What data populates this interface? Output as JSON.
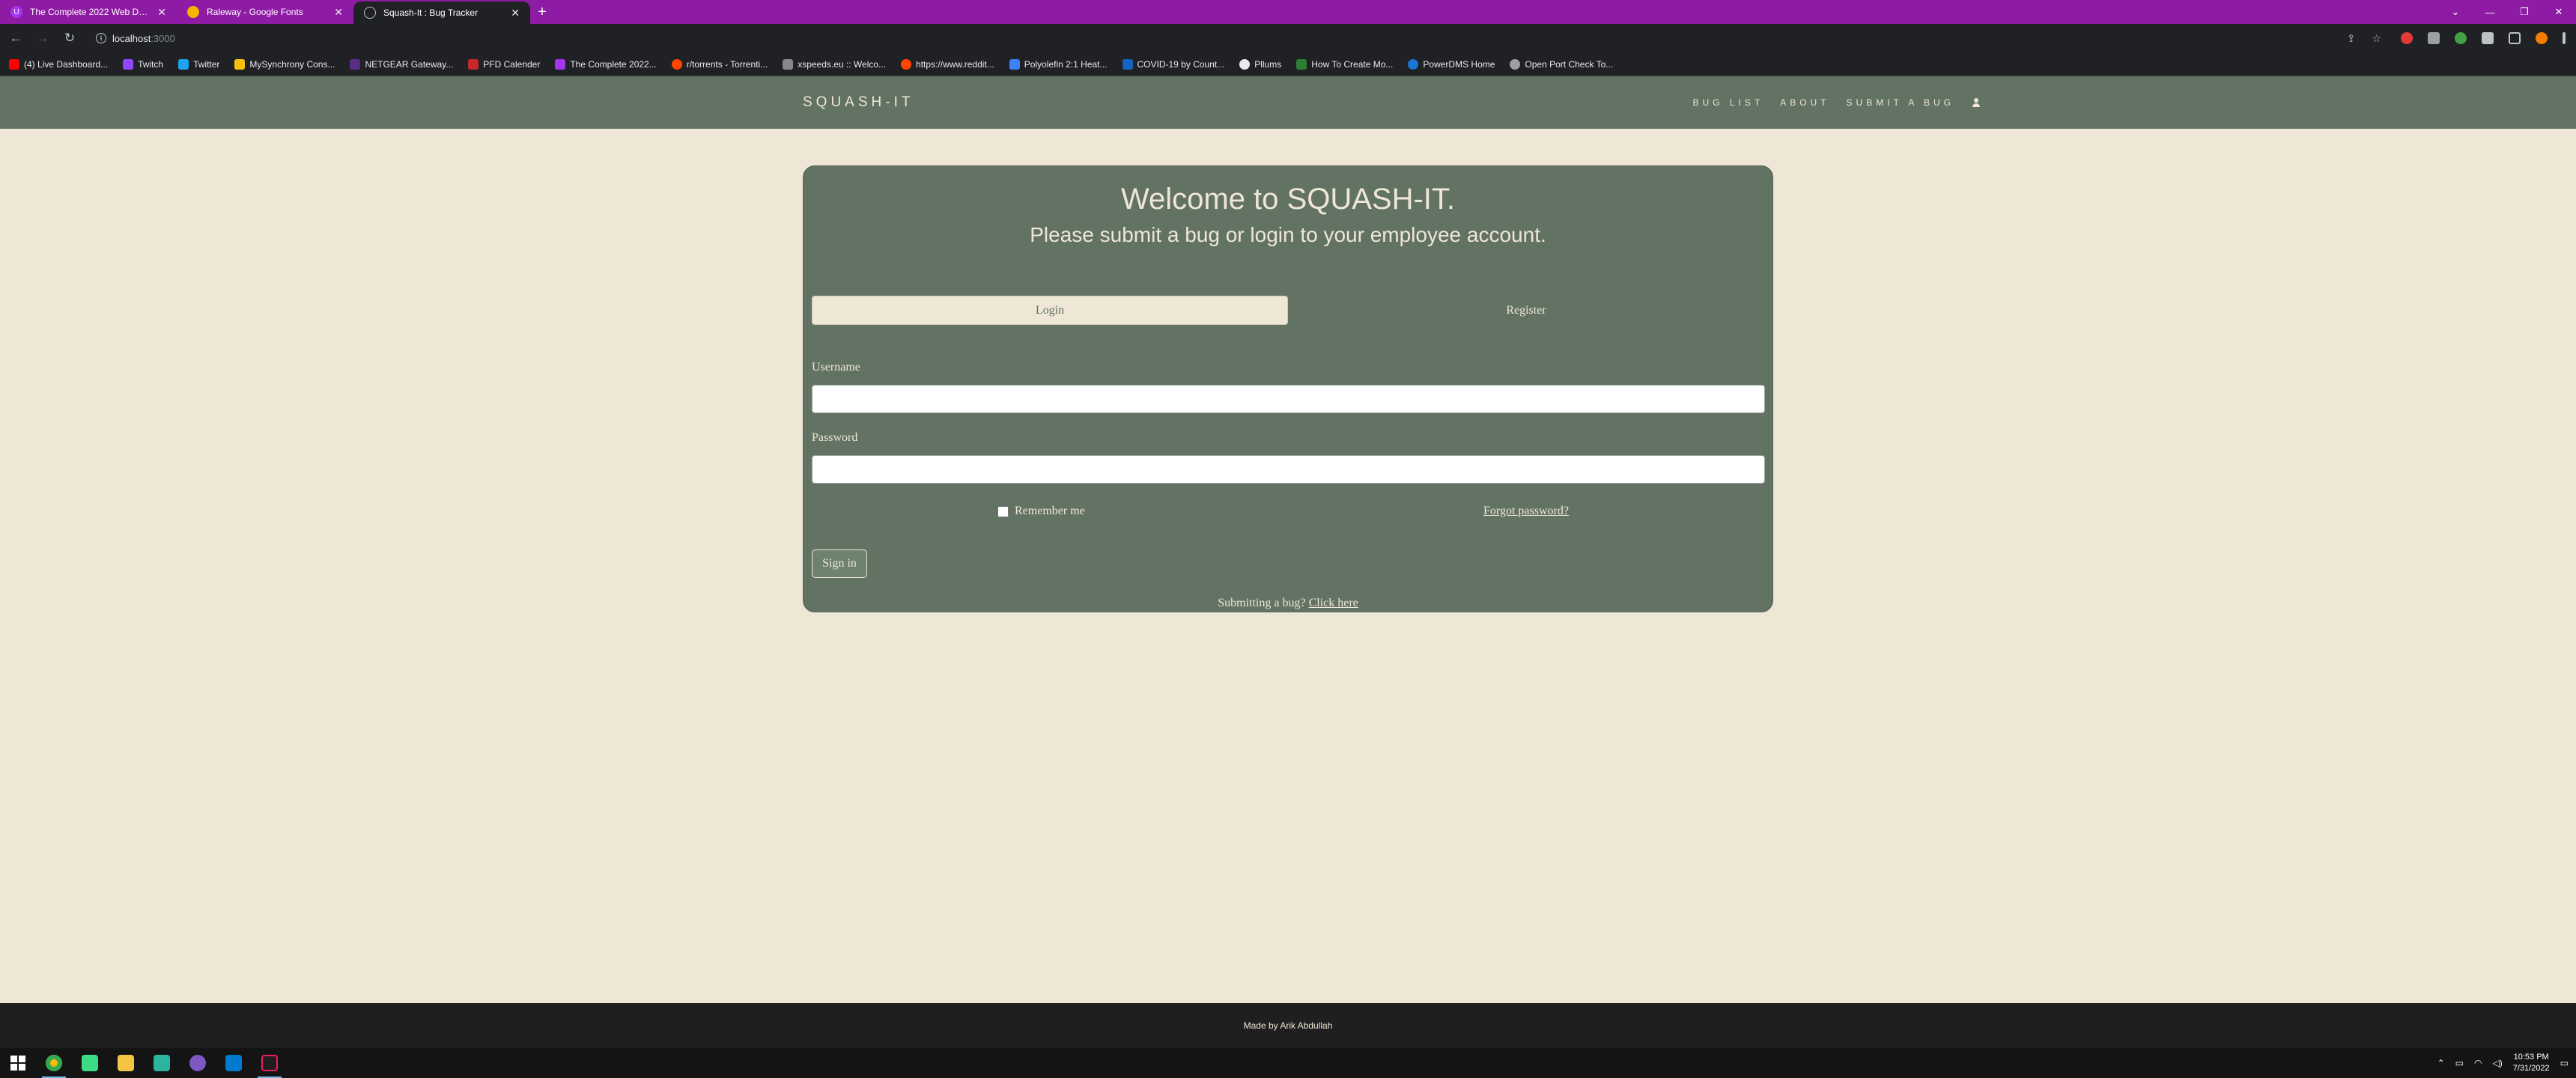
{
  "browser": {
    "tabs": [
      {
        "title": "The Complete 2022 Web Develo...",
        "icon": "udemy-icon",
        "color": "#a435f0"
      },
      {
        "title": "Raleway - Google Fonts",
        "icon": "google-fonts-icon",
        "color": "#f4b400"
      },
      {
        "title": "Squash-It : Bug Tracker",
        "icon": "globe-icon",
        "color": "#5f6368"
      }
    ],
    "url_host": "localhost",
    "url_port": ":3000",
    "bookmarks": [
      {
        "label": "(4) Live Dashboard...",
        "color": "#ff0000"
      },
      {
        "label": "Twitch",
        "color": "#9146ff"
      },
      {
        "label": "Twitter",
        "color": "#1da1f2"
      },
      {
        "label": "MySynchrony Cons...",
        "color": "#f6c00b"
      },
      {
        "label": "NETGEAR Gateway...",
        "color": "#5b2c83"
      },
      {
        "label": "PFD Calender",
        "color": "#c62828"
      },
      {
        "label": "The Complete 2022...",
        "color": "#a435f0"
      },
      {
        "label": "r/torrents - Torrenti...",
        "color": "#ff4500"
      },
      {
        "label": "xspeeds.eu :: Welco...",
        "color": "#888888"
      },
      {
        "label": "https://www.reddit...",
        "color": "#ff4500"
      },
      {
        "label": "Polyolefin 2:1 Heat...",
        "color": "#3b82f6"
      },
      {
        "label": "COVID-19 by Count...",
        "color": "#1565c0"
      },
      {
        "label": "Pllums",
        "color": "#e8eaed"
      },
      {
        "label": "How To Create Mo...",
        "color": "#2e7d32"
      },
      {
        "label": "PowerDMS Home",
        "color": "#1976d2"
      },
      {
        "label": "Open Port Check To...",
        "color": "#9e9e9e"
      }
    ]
  },
  "site": {
    "brand": "SQUASH-IT",
    "nav": {
      "bug_list": "BUG LIST",
      "about": "ABOUT",
      "submit_bug": "SUBMIT A BUG"
    },
    "colors": {
      "primary": "#627363",
      "cream": "#efe7d5"
    }
  },
  "card": {
    "title": "Welcome to SQUASH-IT.",
    "subtitle": "Please submit a bug or login to your employee account.",
    "tab_login": "Login",
    "tab_register": "Register",
    "username_label": "Username",
    "username_value": "",
    "password_label": "Password",
    "password_value": "",
    "remember_label": "Remember me",
    "forgot_label": "Forgot password?",
    "signin_label": "Sign in",
    "submit_prompt": "Submitting a bug?",
    "submit_link": "Click here"
  },
  "footer": {
    "text": "Made by Arik Abdullah"
  },
  "taskbar": {
    "time": "10:53 PM",
    "date": "7/31/2022"
  }
}
